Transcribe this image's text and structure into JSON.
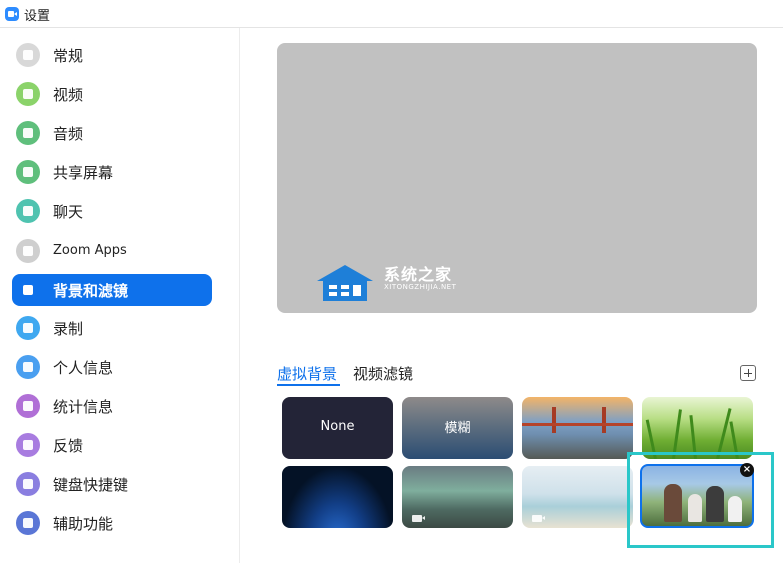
{
  "window": {
    "title": "设置"
  },
  "sidebar": {
    "items": [
      {
        "label": "常规",
        "icon": "gear-icon",
        "color": "#d8d8d8",
        "active": false
      },
      {
        "label": "视频",
        "icon": "video-camera-icon",
        "color": "#8bd36a",
        "active": false
      },
      {
        "label": "音频",
        "icon": "headphones-icon",
        "color": "#5fbf7c",
        "active": false
      },
      {
        "label": "共享屏幕",
        "icon": "share-screen-icon",
        "color": "#5fbf7c",
        "active": false
      },
      {
        "label": "聊天",
        "icon": "chat-bubble-icon",
        "color": "#4fc3b0",
        "active": false
      },
      {
        "label": "Zoom Apps",
        "icon": "zoom-apps-icon",
        "color": "#cfcfcf",
        "active": false
      },
      {
        "label": "背景和滤镜",
        "icon": "background-icon",
        "color": "#0E71EB",
        "active": true
      },
      {
        "label": "录制",
        "icon": "record-icon",
        "color": "#3fa8f0",
        "active": false
      },
      {
        "label": "个人信息",
        "icon": "profile-icon",
        "color": "#4a9ff0",
        "active": false
      },
      {
        "label": "统计信息",
        "icon": "statistics-icon",
        "color": "#b06fd6",
        "active": false
      },
      {
        "label": "反馈",
        "icon": "feedback-smiley-icon",
        "color": "#a87ce0",
        "active": false
      },
      {
        "label": "键盘快捷键",
        "icon": "keyboard-icon",
        "color": "#8a7ee0",
        "active": false
      },
      {
        "label": "辅助功能",
        "icon": "accessibility-icon",
        "color": "#5a76d6",
        "active": false
      }
    ]
  },
  "watermark": {
    "title": "系统之家",
    "subtitle": "XITONGZHIJIA.NET"
  },
  "tabs": [
    {
      "label": "虚拟背景",
      "active": true
    },
    {
      "label": "视频滤镜",
      "active": false
    }
  ],
  "add_button": {
    "icon": "plus-icon"
  },
  "backgrounds": [
    {
      "label": "None",
      "name": "none"
    },
    {
      "label": "模糊",
      "name": "blur"
    },
    {
      "label": "",
      "name": "golden-gate-bridge"
    },
    {
      "label": "",
      "name": "grass"
    },
    {
      "label": "",
      "name": "earth-from-space",
      "video": false
    },
    {
      "label": "",
      "name": "aurora",
      "video": true
    },
    {
      "label": "",
      "name": "beach-palm",
      "video": true
    },
    {
      "label": "",
      "name": "family-photo",
      "selected": true
    }
  ],
  "close_badge": {
    "symbol": "×"
  },
  "accent_color": "#0E71EB",
  "highlight_color": "#2ac7c9"
}
